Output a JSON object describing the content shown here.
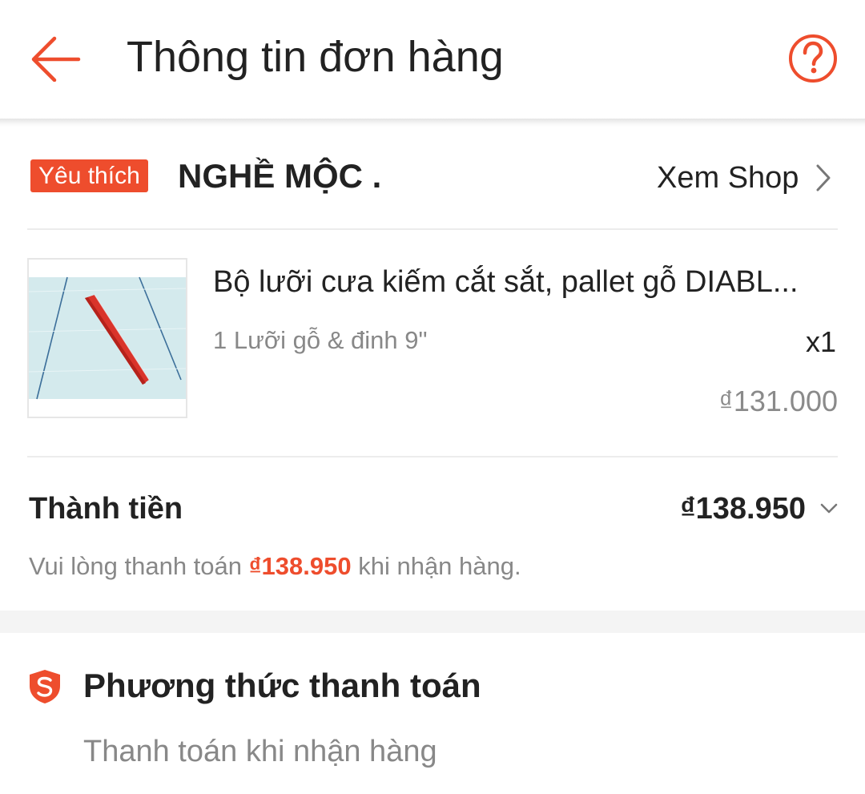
{
  "header": {
    "title": "Thông tin đơn hàng",
    "back_icon": "arrow-left-icon",
    "help_icon": "question-circle-icon"
  },
  "shop": {
    "badge": "Yêu thích",
    "name": "NGHỀ MỘC .",
    "view_shop_label": "Xem Shop"
  },
  "product": {
    "name": "Bộ lưỡi cưa kiếm cắt sắt, pallet gỗ DIABL...",
    "variation": "1 Lưỡi gỗ & đinh 9\"",
    "quantity": "x1",
    "unit_price": "₫131.000"
  },
  "total": {
    "label": "Thành tiền",
    "value": "₫138.950",
    "note_prefix": "Vui lòng thanh toán ",
    "note_amount": "₫138.950",
    "note_suffix": " khi nhận hàng."
  },
  "payment": {
    "title": "Phương thức thanh toán",
    "method": "Thanh toán khi nhận hàng"
  },
  "colors": {
    "accent": "#ee4d2d",
    "text_primary": "#222222",
    "text_secondary": "#888888"
  }
}
